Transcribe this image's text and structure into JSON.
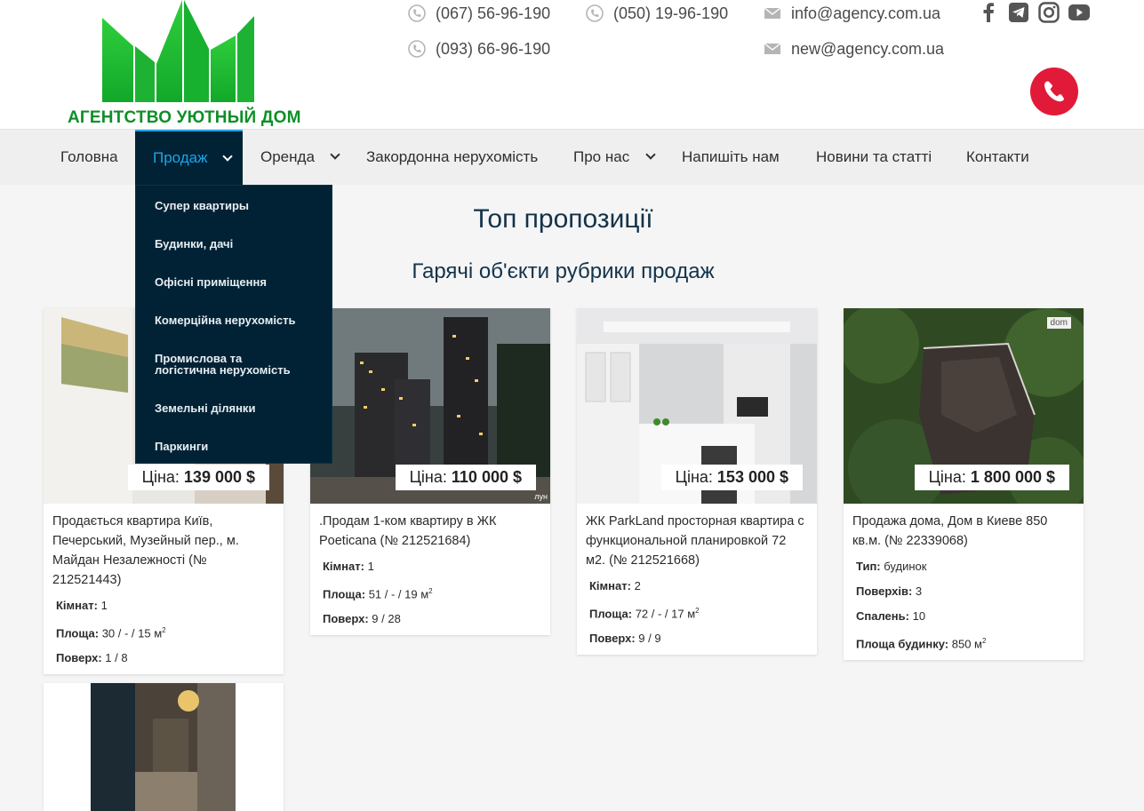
{
  "header": {
    "logo_text": "АГЕНТСТВО УЮТНЫЙ ДОМ",
    "phones": [
      "(067) 56-96-190",
      "(050) 19-96-190",
      "(093) 66-96-190"
    ],
    "emails": [
      "info@agency.com.ua",
      "new@agency.com.ua"
    ],
    "socials": [
      "facebook-icon",
      "telegram-icon",
      "instagram-icon",
      "youtube-icon"
    ]
  },
  "nav": {
    "items": [
      "Головна",
      "Продаж",
      "Оренда",
      "Закордонна нерухомість",
      "Про нас",
      "Напишіть нам",
      "Новини та статті",
      "Контакти"
    ],
    "dropdown": [
      "Супер квартиры",
      "Будинки, дачі",
      "Офісні приміщення",
      "Комерційна нерухомість",
      "Промислова та",
      "логістична нерухомість",
      "Земельні ділянки",
      "Паркинги"
    ]
  },
  "main": {
    "title": "Топ пропозиції",
    "subtitle": "Гарячі об'єкти рубрики продаж"
  },
  "listings": [
    {
      "price_label": "Ціна:",
      "price": "139 000 $",
      "title": "Продається квартира Київ, Печерський, Музейный пер., м. Майдан Незалежності  (№ 212521443)",
      "attrs": [
        {
          "label": "Кімнат:",
          "value": "1"
        },
        {
          "label": "Площа:",
          "value": "30 / - / 15 м"
        },
        {
          "label": "Поверх:",
          "value": "1 / 8"
        }
      ]
    },
    {
      "price_label": "Ціна:",
      "price": "110 000 $",
      "title": ".Продам 1-ком квартиру в ЖК Poeticana  (№ 212521684)",
      "attrs": [
        {
          "label": "Кімнат:",
          "value": "1"
        },
        {
          "label": "Площа:",
          "value": "51 / - / 19 м"
        },
        {
          "label": "Поверх:",
          "value": "9 / 28"
        }
      ]
    },
    {
      "price_label": "Ціна:",
      "price": "153 000 $",
      "title": "ЖК ParkLand просторная квартира с функциональной планировкой 72 м2.  (№ 212521668)",
      "attrs": [
        {
          "label": "Кімнат:",
          "value": "2"
        },
        {
          "label": "Площа:",
          "value": "72 / - / 17 м"
        },
        {
          "label": "Поверх:",
          "value": "9 / 9"
        }
      ]
    },
    {
      "price_label": "Ціна:",
      "price": "1 800 000 $",
      "title": "Продажа дома, Дом в Киеве 850 кв.м.  (№ 22339068)",
      "attrs": [
        {
          "label": "Тип:",
          "value": "будинок"
        },
        {
          "label": "Поверхів:",
          "value": "3"
        },
        {
          "label": "Спалень:",
          "value": "10"
        },
        {
          "label": "Площа будинку:",
          "value": "850 м"
        }
      ]
    }
  ],
  "sup": "2",
  "watermarks": {
    "lun": "лун",
    "dom": "dom"
  },
  "colors": {
    "nav_active_bg": "#012235",
    "nav_active_text": "#1ea5e6",
    "heading": "#12334a",
    "call_button": "#e21a39",
    "logo_green": "#0e8f27"
  }
}
